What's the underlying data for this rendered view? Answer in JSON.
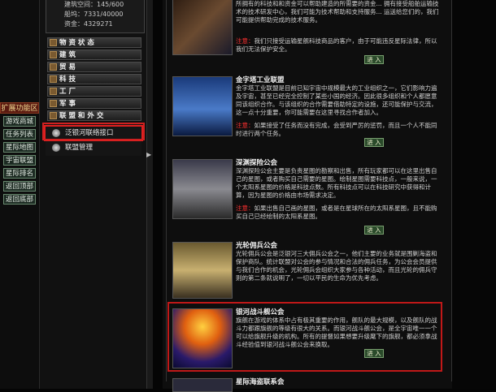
{
  "stats": {
    "building_space": "建筑空间：145/600",
    "ships": "船坞：7331/40000",
    "funds": "资金：4329271"
  },
  "menu": [
    {
      "label": "物 资 状 态"
    },
    {
      "label": "建  筑"
    },
    {
      "label": "贸  易"
    },
    {
      "label": "科  技"
    },
    {
      "label": "工  厂"
    },
    {
      "label": "军  事"
    },
    {
      "label": "联 盟 和 外 交"
    }
  ],
  "submenu": [
    {
      "label": "泛银河联络接口"
    },
    {
      "label": "联盟管理"
    }
  ],
  "ext": {
    "header": "扩展功能区",
    "buttons": [
      "游戏商城",
      "任务列表",
      "星际地图",
      "宇宙联盟",
      "星际排名",
      "返回顶部",
      "返回底部"
    ]
  },
  "entries": [
    {
      "title": "",
      "desc": "所拥有的科技和和资金可以帮助建造的所需要的资金... 拥有接受船舶运输技术的技术研发中心，我们可能为技术帮助和支持服务... 运送给您们的，我们可能提供帮助完成的技术服务。",
      "note_label": "注意：",
      "note": "我们只接受运输星舰科技商品的客户，由于可能违反星际法律，所以我们无法保护安全。",
      "enter": "进 入"
    },
    {
      "title": "金字塔工业联盟",
      "desc": "金字塔工业联盟是目前已知宇宙中规模最大的工业组织之一，它们影响力遍及宇宙，甚至已经完全控制了某些小国的经济。因此很多组织和个人都愿意同该组织合作。与该组织的合作需要借助特定的设施，还可能保护与交流，这一点十分重要，你可能需要在这里寻找合作者加入。",
      "note_label": "注意：",
      "note": "如果接受了任务而没有完成，会受到严厉的惩罚，而且一个人不能同时进行两个任务。",
      "enter": "进 入"
    },
    {
      "title": "深渊探险公会",
      "desc": "深渊探险公会主要是负责星图的勘察和出售，所有玩家都可以在这里出售自己的星图，或者购买自己需要的星图。绘制星图需要科技点，一般来说，一个太阳系星图的价格是科技点数。所有科技点可以在科技研究中获得和计算，因为星图的价格由市场需求决定。",
      "note_label": "注意：",
      "note": "如果出售自己画的星图，或者是在星球所在的太阳系星图，且不能购买自己已经绘制的太阳系星图。",
      "enter": "进 入"
    },
    {
      "title": "光轮佣兵公会",
      "desc": "光轮佣兵公会是泛银河三大佣兵公会之一，他们主要的业务就是围剿海盗和保护商队。统计联盟对公会的参与情况和合法的佣兵任务，为公会会员提供与我们合作的机会，光轮佣兵会组织大家参与各种活动，而且光轮的佣兵守则的第二条就说明了，一切以平民的生命为优先考虑。",
      "note_label": "",
      "note": "",
      "enter": "进 入"
    },
    {
      "title": "银河战斗舰公会",
      "desc": "旗舰在游戏的体系中占有极其重要的作用，舰队的最大规模，以及舰队的战斗力都跟旗舰的等级有很大的关系。而银河战斗舰公会，是全宇宙唯一一个可以给旗舰升级的机构。所有的提督如果想要升级麾下的旗舰，都必须拿战斗经验值到银河战斗舰公会来换取。",
      "note_label": "",
      "note": "",
      "enter": "进 入"
    },
    {
      "title": "星际海盗联系会",
      "desc": "",
      "note_label": "",
      "note": "",
      "enter": ""
    }
  ],
  "colors": {
    "highlight": "#d02020",
    "enter_bg": "#2a4a2a",
    "ext_header_bg": "#5a1a10"
  }
}
